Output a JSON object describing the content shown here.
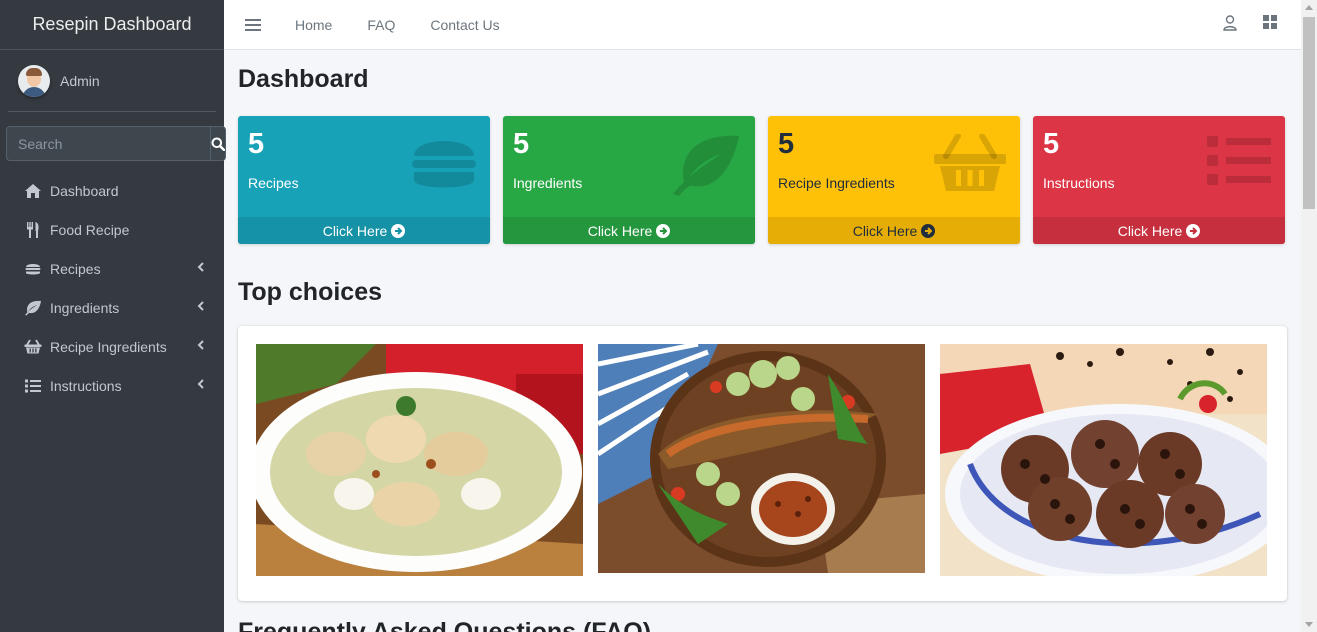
{
  "brand": "Resepin Dashboard",
  "user": {
    "name": "Admin"
  },
  "search": {
    "placeholder": "Search"
  },
  "nav": [
    {
      "label": "Dashboard",
      "icon": "home-icon"
    },
    {
      "label": "Food Recipe",
      "icon": "utensils-icon"
    },
    {
      "label": "Recipes",
      "icon": "hamburger-icon",
      "expandable": true
    },
    {
      "label": "Ingredients",
      "icon": "leaf-icon",
      "expandable": true
    },
    {
      "label": "Recipe Ingredients",
      "icon": "basket-icon",
      "expandable": true
    },
    {
      "label": "Instructions",
      "icon": "list-icon",
      "expandable": true
    }
  ],
  "topnav": {
    "links": [
      "Home",
      "FAQ",
      "Contact Us"
    ]
  },
  "page": {
    "title": "Dashboard"
  },
  "cards": [
    {
      "count": "5",
      "label": "Recipes",
      "link": "Click Here",
      "color": "#17a2b8",
      "icon": "hamburger-icon"
    },
    {
      "count": "5",
      "label": "Ingredients",
      "link": "Click Here",
      "color": "#28a745",
      "icon": "leaf-icon"
    },
    {
      "count": "5",
      "label": "Recipe Ingredients",
      "link": "Click Here",
      "color": "#ffc107",
      "icon": "basket-icon"
    },
    {
      "count": "5",
      "label": "Instructions",
      "link": "Click Here",
      "color": "#dc3545",
      "icon": "list-icon"
    }
  ],
  "top_choices": {
    "title": "Top choices",
    "photos": [
      "opor-ayam-photo",
      "grilled-fish-photo",
      "chocolate-cookies-photo"
    ]
  },
  "faq": {
    "title": "Frequently Asked Questions (FAQ)"
  }
}
